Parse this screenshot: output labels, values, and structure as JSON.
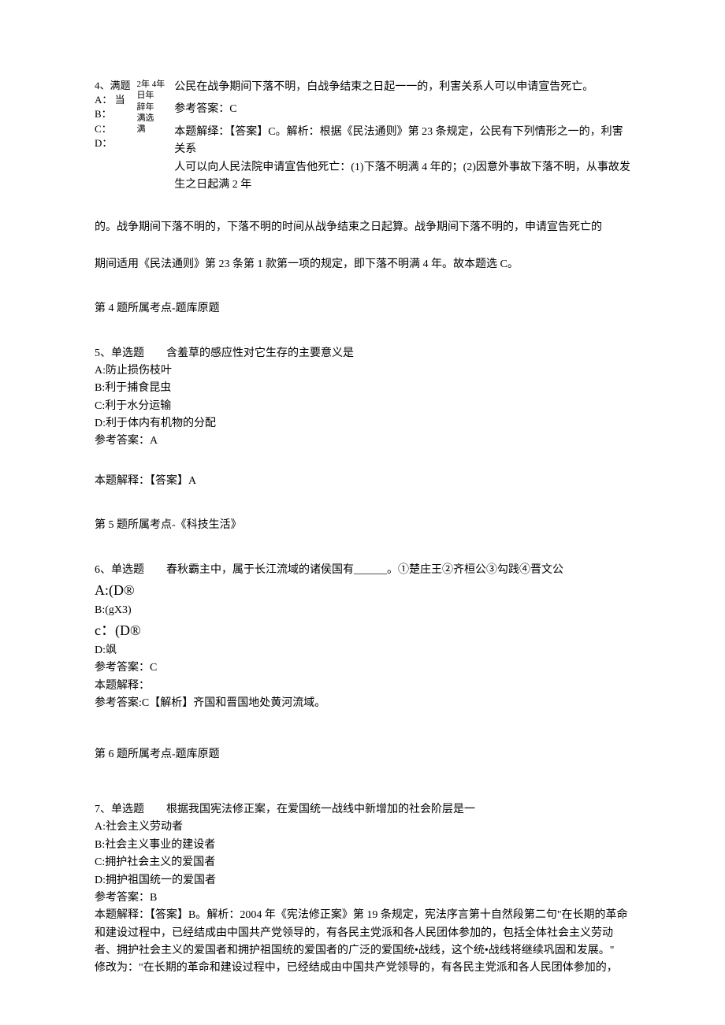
{
  "q4": {
    "left": {
      "r1": "4、满题",
      "r2": "A： 当",
      "r3": "B：",
      "r4": "C：",
      "r5": "D："
    },
    "mid": {
      "r1": "2年 4年",
      "r2": "日年",
      "r3": "辞年",
      "r4": "满选",
      "r5": "满"
    },
    "right": {
      "stem": "公民在战争期间下落不明，白战争结束之日起一一的，利害关系人可以申请宣告死亡。",
      "ansLabel": "参考答案：C",
      "explain1": "本题解绎：【答案】C。解析：根据《民法通则》第 23 条规定，公民有下列情形之一的，利害关系",
      "explain2": "人可以向人民法院申请宣告他死亡：(1)下落不明满 4 年的；(2)因意外事故下落不明，从事故发",
      "explain3": "生之日起满 2 年"
    },
    "p1": "的。战争期间下落不明的，下落不明的时间从战争结束之日起算。战争期间下落不明的，申请宣告死亡的",
    "p2": "期间适用《民法通则》第 23 条第 1 款第一项的规定，即下落不明满 4 年。故本题选 C。",
    "point": "第 4 题所属考点-题库原题"
  },
  "q5": {
    "stem": "5、单选题　　含羞草的感应性对它生存的主要意义是",
    "optA": "A:防止损伤枝叶",
    "optB": "B:利于捕食昆虫",
    "optC": "C:利于水分运输",
    "optD": "D:利于体内有机物的分配",
    "ans": "参考答案：A",
    "explain": "本题解释：【答案】A",
    "point": "第 5 题所属考点-《科技生活》"
  },
  "q6": {
    "stem": "6、单选题　　春秋霸主中，属于长江流域的诸侯国有______。①楚庄王②齐桓公③勾践④晋文公",
    "optA": "A:(D®",
    "optB": "B:(gX3)",
    "optC": "c：(D®",
    "optD": "D:飒",
    "ans": "参考答案：C",
    "explainLabel": "本题解释：",
    "explain": "参考答案:C【解析】齐国和晋国地处黄河流域。",
    "point": "第 6 题所属考点-题库原题"
  },
  "q7": {
    "stem": "7、单选题　　根据我国宪法修正案，在爱国统一战线中新增加的社会阶层是一",
    "optA": "A:社会主义劳动者",
    "optB": "B:社会主义事业的建设者",
    "optC": "C:拥护社会主义的爱国者",
    "optD": "D:拥护祖国统一的爱国者",
    "ans": "参考答案：B",
    "explain1": "本题解释：【答案】B。解析：2004 年《宪法修正案》第 19 条规定，宪法序言第十自然段第二句\"在长期的革命",
    "explain2": "和建设过程中，已经结成由中国共产党领导的，有各民主党派和各人民团体参加的，包括全体社会主义劳动",
    "explain3": "者、拥护社会主义的爱国者和拥护祖国统的爱国者的广泛的爱国统•战线，这个统•战线将继续巩固和发展。\"",
    "explain4": "修改为：\"在长期的革命和建设过程中，已经结成由中国共产党领导的，有各民主党派和各人民团体参加的，"
  }
}
